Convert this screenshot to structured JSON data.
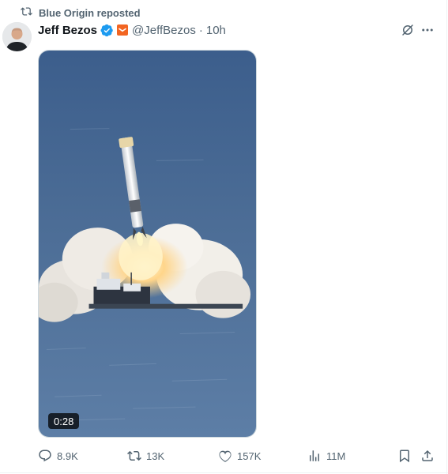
{
  "repost": {
    "label": "Blue Origin reposted"
  },
  "author": {
    "name": "Jeff Bezos",
    "handle": "@JeffBezos",
    "separator": "·",
    "time": "10h"
  },
  "media": {
    "duration": "0:28"
  },
  "actions": {
    "replies": "8.9K",
    "reposts": "13K",
    "likes": "157K",
    "views": "11M"
  },
  "colors": {
    "verified": "#1d9bf0",
    "affiliate_badge": "#f26522",
    "secondary_text": "#536471",
    "sea": "#4e6f97"
  },
  "icons": {
    "repost": "repost-icon",
    "verified": "verified-badge-icon",
    "affiliate": "affiliate-badge-icon",
    "grok": "grok-icon",
    "more": "more-icon",
    "reply": "reply-icon",
    "like": "heart-icon",
    "views": "views-icon",
    "bookmark": "bookmark-icon",
    "share": "share-icon"
  }
}
